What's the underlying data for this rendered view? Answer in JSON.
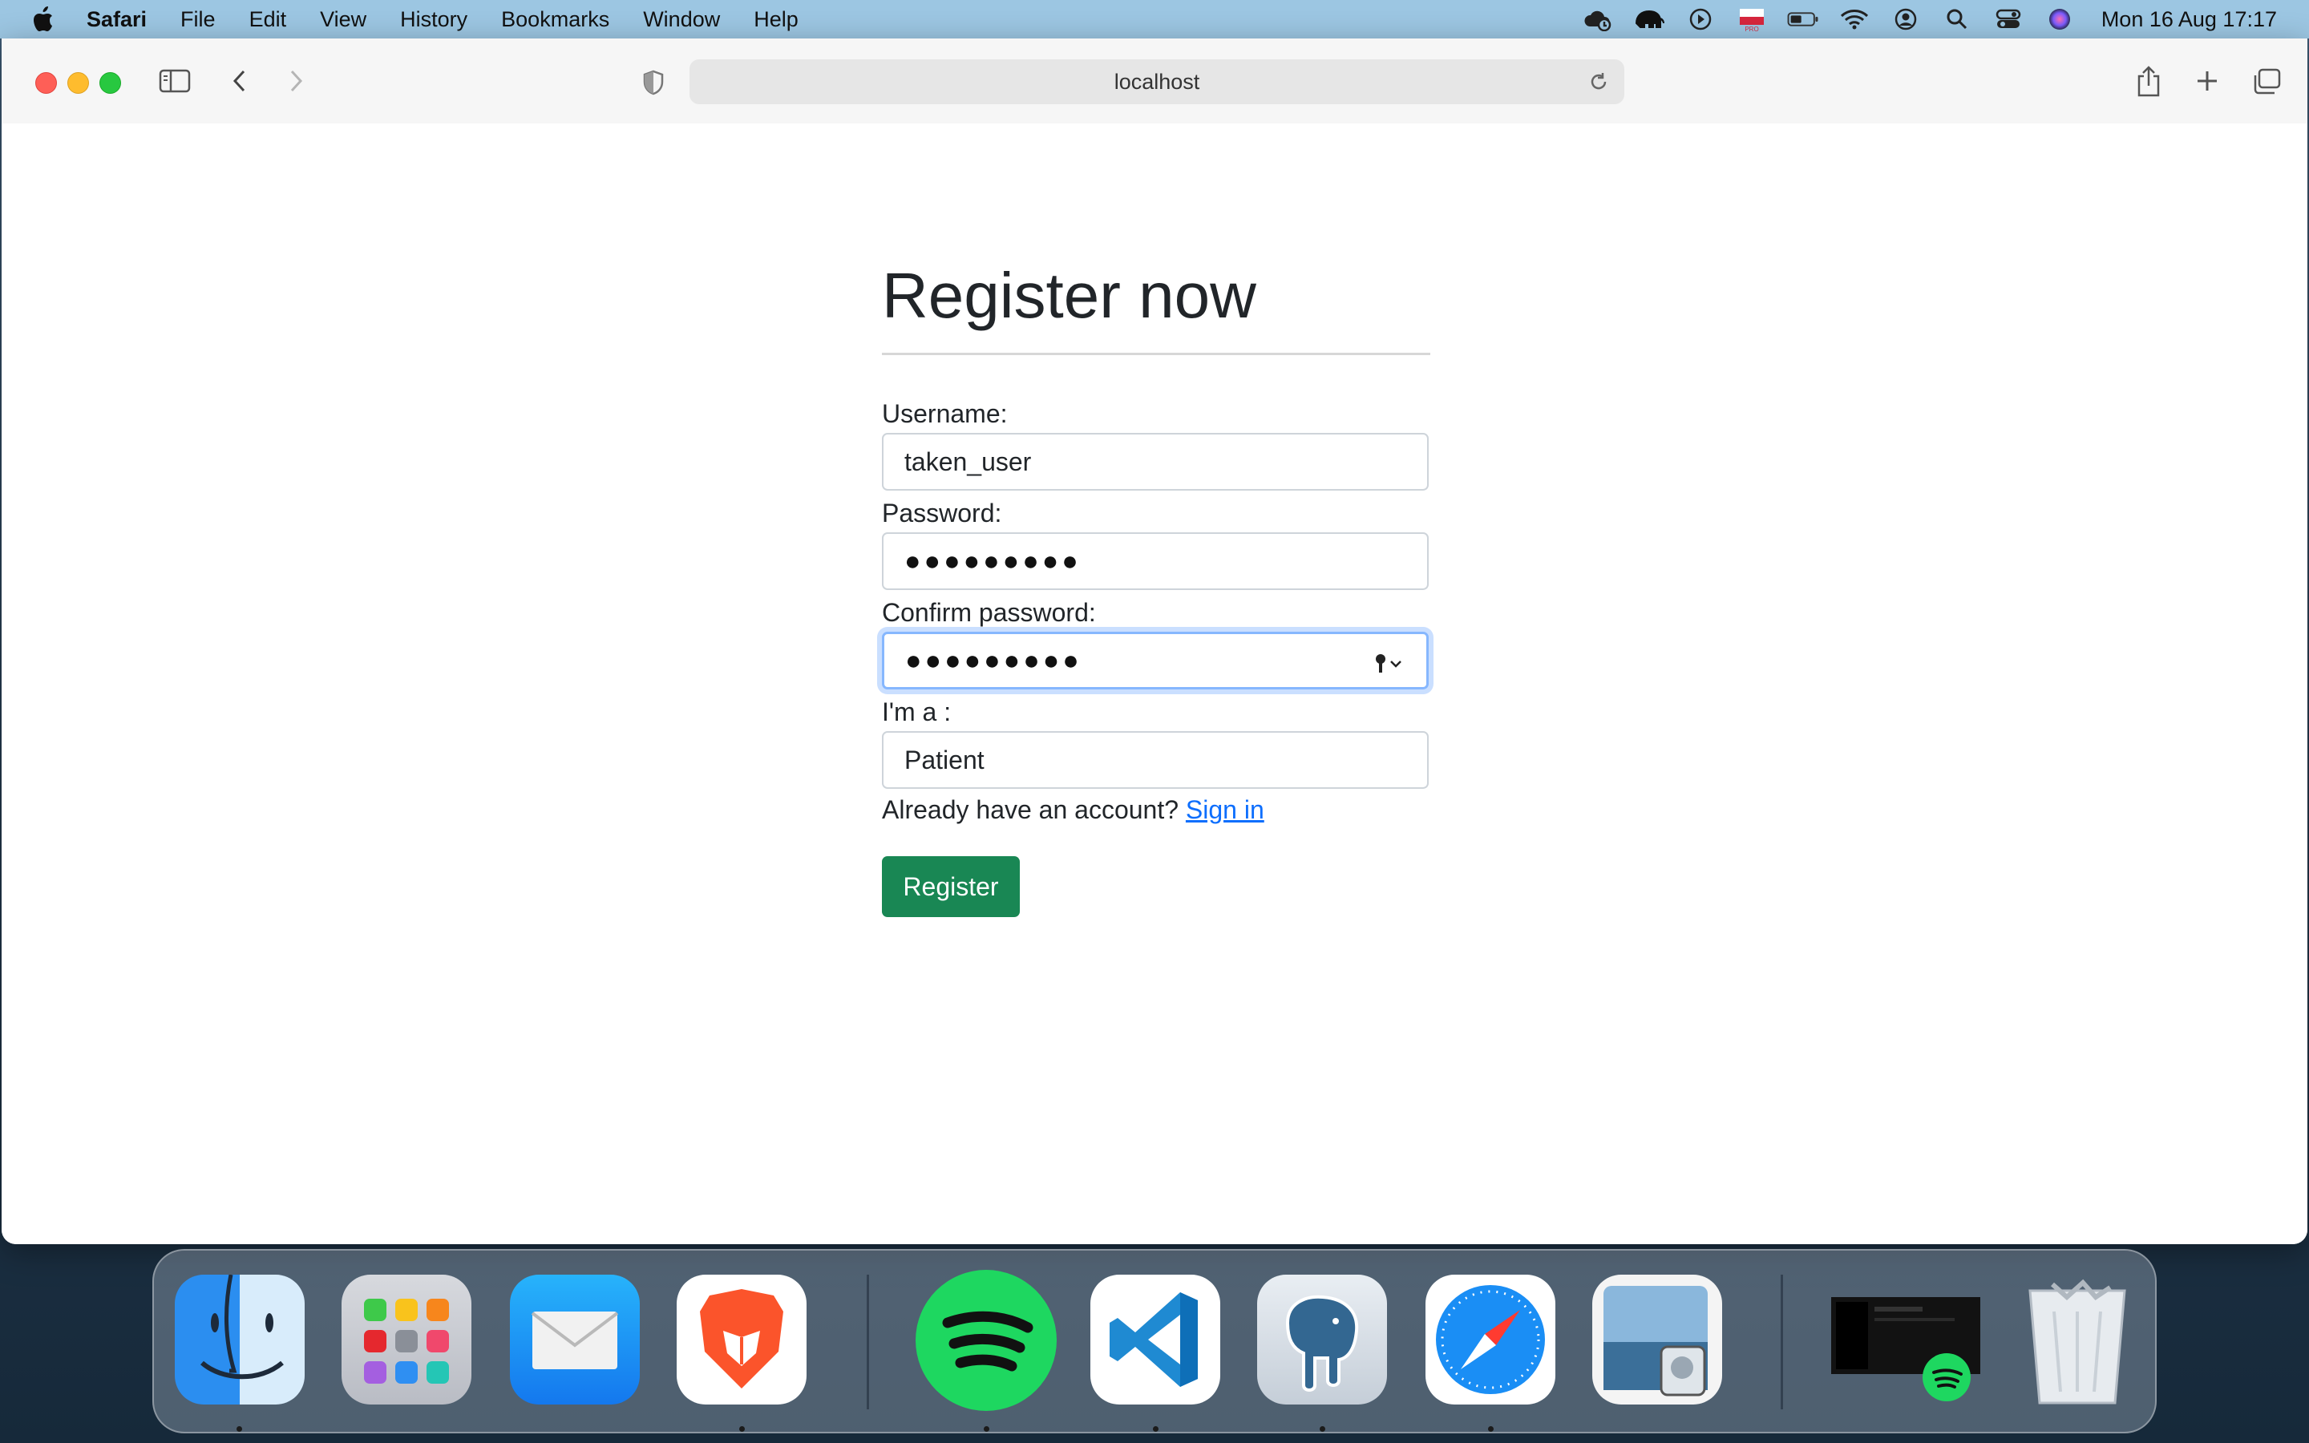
{
  "menubar": {
    "app_name": "Safari",
    "items": [
      "File",
      "Edit",
      "View",
      "History",
      "Bookmarks",
      "Window",
      "Help"
    ],
    "clock": "Mon 16 Aug  17:17",
    "status_icons": [
      "cloud-sync-icon",
      "elephant-icon",
      "play-icon",
      "flag-icon",
      "battery-icon",
      "wifi-icon",
      "user-icon",
      "search-icon",
      "control-center-icon",
      "siri-icon"
    ]
  },
  "browser": {
    "url": "localhost"
  },
  "form": {
    "title": "Register now",
    "username_label": "Username:",
    "username_value": "taken_user",
    "password_label": "Password:",
    "password_value": "●●●●●●●●●",
    "confirm_label": "Confirm password:",
    "confirm_value": "●●●●●●●●●",
    "role_label": "I'm a :",
    "role_value": "Patient",
    "signin_prompt": "Already have an account?",
    "signin_link": "Sign in",
    "register_button": "Register"
  },
  "colors": {
    "accent_green": "#198754",
    "link_blue": "#0d6efd",
    "focus_ring": "#86b7fe"
  },
  "dock": {
    "apps": [
      "Finder",
      "Launchpad",
      "Mail",
      "Brave",
      "Spotify",
      "Visual Studio Code",
      "Postgres",
      "Safari",
      "Preview",
      "Spotify window",
      "Trash"
    ]
  }
}
